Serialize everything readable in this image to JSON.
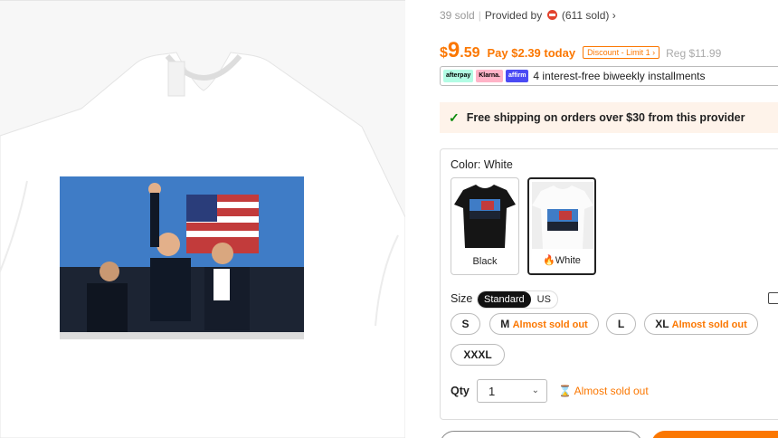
{
  "colors": {
    "accent": "#fb7701",
    "check": "#0a8a0a",
    "ship_bg": "#fef3ea"
  },
  "product": {
    "sold_count": "39 sold",
    "provided_by": "Provided by",
    "provider_sold": "(611 sold)",
    "provider_chevron": "›"
  },
  "price": {
    "currency": "$",
    "integer": "9",
    "decimal": ".59",
    "pay_today": "Pay $2.39 today",
    "discount_tag": "Discount - Limit 1 ›",
    "regular": "Reg $11.99"
  },
  "installments": {
    "badges": [
      "afterpay",
      "Klarna.",
      "affirm"
    ],
    "text": "4 interest-free biweekly installments"
  },
  "shipping": {
    "icon": "check-icon",
    "text": "Free shipping on orders over $30 from this provider"
  },
  "color_option": {
    "label": "Color: White",
    "swatches": [
      {
        "label": "Black",
        "selected": false
      },
      {
        "label": "White",
        "selected": true,
        "badge_icon": "flame-icon"
      }
    ]
  },
  "size_option": {
    "label": "Size",
    "systems": [
      "Standard",
      "US"
    ],
    "active_system": "Standard",
    "sizes": [
      {
        "label": "S",
        "note": ""
      },
      {
        "label": "M",
        "note": "Almost sold out"
      },
      {
        "label": "L",
        "note": ""
      },
      {
        "label": "XL",
        "note": "Almost sold out"
      },
      {
        "label": "XXXL",
        "note": ""
      }
    ]
  },
  "quantity": {
    "label": "Qty",
    "value": "1",
    "chevron": "⌄",
    "stock_note": "Almost sold out",
    "stock_icon": "hourglass-icon"
  }
}
